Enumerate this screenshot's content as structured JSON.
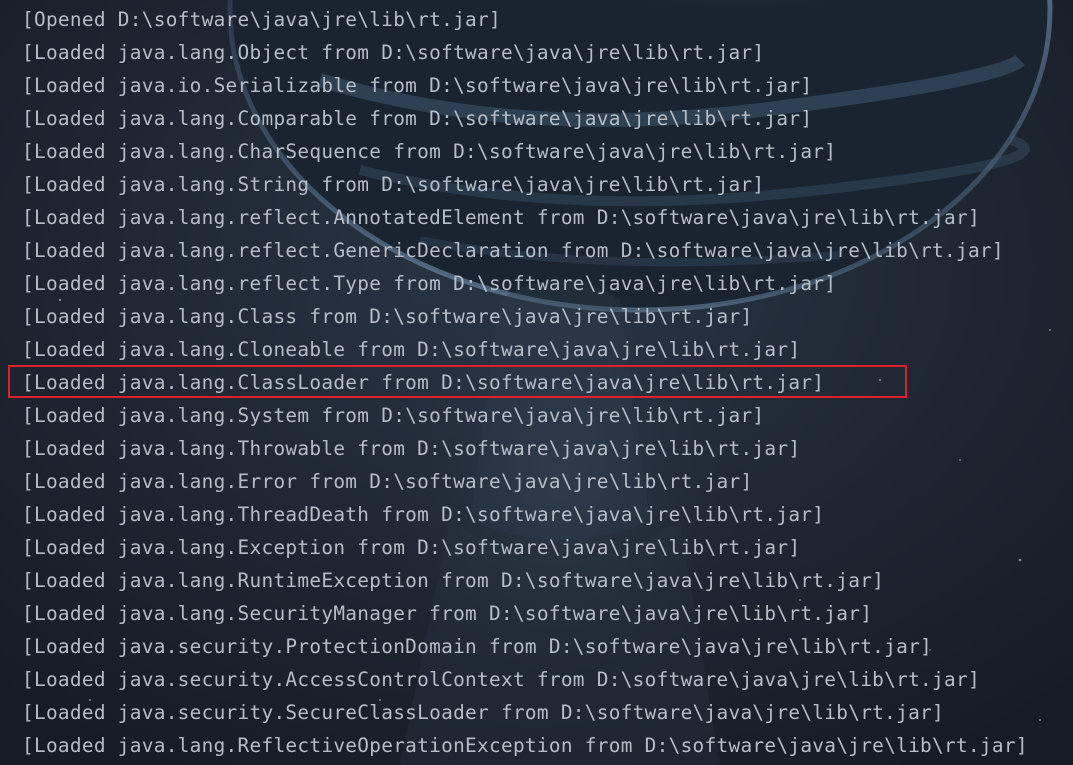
{
  "console": {
    "lines": [
      "[Opened D:\\software\\java\\jre\\lib\\rt.jar]",
      "[Loaded java.lang.Object from D:\\software\\java\\jre\\lib\\rt.jar]",
      "[Loaded java.io.Serializable from D:\\software\\java\\jre\\lib\\rt.jar]",
      "[Loaded java.lang.Comparable from D:\\software\\java\\jre\\lib\\rt.jar]",
      "[Loaded java.lang.CharSequence from D:\\software\\java\\jre\\lib\\rt.jar]",
      "[Loaded java.lang.String from D:\\software\\java\\jre\\lib\\rt.jar]",
      "[Loaded java.lang.reflect.AnnotatedElement from D:\\software\\java\\jre\\lib\\rt.jar]",
      "[Loaded java.lang.reflect.GenericDeclaration from D:\\software\\java\\jre\\lib\\rt.jar]",
      "[Loaded java.lang.reflect.Type from D:\\software\\java\\jre\\lib\\rt.jar]",
      "[Loaded java.lang.Class from D:\\software\\java\\jre\\lib\\rt.jar]",
      "[Loaded java.lang.Cloneable from D:\\software\\java\\jre\\lib\\rt.jar]",
      "[Loaded java.lang.ClassLoader from D:\\software\\java\\jre\\lib\\rt.jar]",
      "[Loaded java.lang.System from D:\\software\\java\\jre\\lib\\rt.jar]",
      "[Loaded java.lang.Throwable from D:\\software\\java\\jre\\lib\\rt.jar]",
      "[Loaded java.lang.Error from D:\\software\\java\\jre\\lib\\rt.jar]",
      "[Loaded java.lang.ThreadDeath from D:\\software\\java\\jre\\lib\\rt.jar]",
      "[Loaded java.lang.Exception from D:\\software\\java\\jre\\lib\\rt.jar]",
      "[Loaded java.lang.RuntimeException from D:\\software\\java\\jre\\lib\\rt.jar]",
      "[Loaded java.lang.SecurityManager from D:\\software\\java\\jre\\lib\\rt.jar]",
      "[Loaded java.security.ProtectionDomain from D:\\software\\java\\jre\\lib\\rt.jar]",
      "[Loaded java.security.AccessControlContext from D:\\software\\java\\jre\\lib\\rt.jar]",
      "[Loaded java.security.SecureClassLoader from D:\\software\\java\\jre\\lib\\rt.jar]",
      "[Loaded java.lang.ReflectiveOperationException from D:\\software\\java\\jre\\lib\\rt.jar]"
    ],
    "highlighted_line_index": 11,
    "text_color": "#b6bdc6",
    "highlight_color": "#e0212b"
  },
  "background": {
    "description_icon": "planet-space-wallpaper"
  }
}
